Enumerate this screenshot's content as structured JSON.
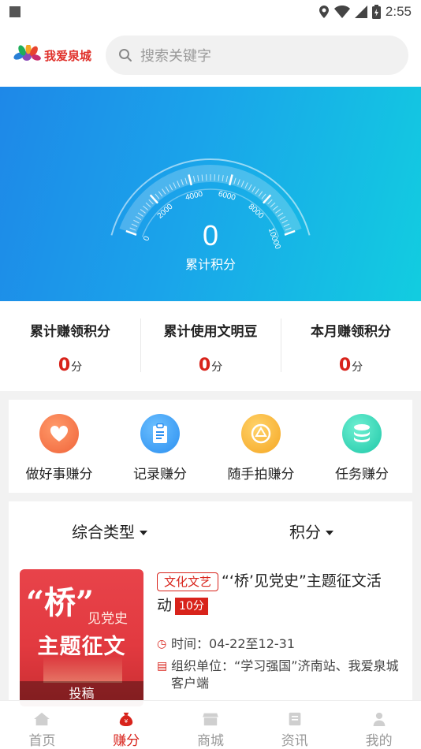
{
  "status_bar": {
    "time": "2:55"
  },
  "header": {
    "logo_text": "我爱泉城",
    "search_placeholder": "搜索关键字"
  },
  "gauge": {
    "value": "0",
    "label": "累计积分",
    "ticks": [
      "0",
      "2000",
      "4000",
      "6000",
      "8000",
      "10000"
    ],
    "progress": 0
  },
  "stats": [
    {
      "label": "累计赚领积分",
      "value": "0",
      "unit": "分"
    },
    {
      "label": "累计使用文明豆",
      "value": "0",
      "unit": "分"
    },
    {
      "label": "本月赚领积分",
      "value": "0",
      "unit": "分"
    }
  ],
  "actions": [
    {
      "label": "做好事赚分",
      "icon": "heart-icon",
      "color": "#f0643a"
    },
    {
      "label": "记录赚分",
      "icon": "clipboard-icon",
      "color": "#2b8ff0"
    },
    {
      "label": "随手拍赚分",
      "icon": "camera-shutter-icon",
      "color": "#f5a623"
    },
    {
      "label": "任务赚分",
      "icon": "stack-icon",
      "color": "#1fc7a8"
    }
  ],
  "filters": {
    "type_label": "综合类型",
    "points_label": "积分"
  },
  "activity": {
    "tag": "文化文艺",
    "title": "“‘桥’见党史”主题征文活动",
    "title_display_1": "“‘桥’见党史”主题征文活",
    "title_display_2": "动",
    "points": "10分",
    "time_label": "时间：",
    "time_value": "04-22至12-31",
    "org_label": "组织单位：",
    "org_value": "“学习强国”济南站、我爱泉城客户端",
    "thumb_quote": "“桥”",
    "thumb_sub": "见党史",
    "thumb_main": "主题征文",
    "thumb_button": "投稿"
  },
  "bottom_nav": [
    {
      "label": "首页",
      "icon": "home-icon",
      "active": false
    },
    {
      "label": "赚分",
      "icon": "money-bag-icon",
      "active": true
    },
    {
      "label": "商城",
      "icon": "shop-icon",
      "active": false
    },
    {
      "label": "资讯",
      "icon": "news-icon",
      "active": false
    },
    {
      "label": "我的",
      "icon": "user-icon",
      "active": false
    }
  ],
  "colors": {
    "accent_red": "#d8231b",
    "hero_start": "#1e88e8",
    "hero_end": "#12cde0"
  }
}
